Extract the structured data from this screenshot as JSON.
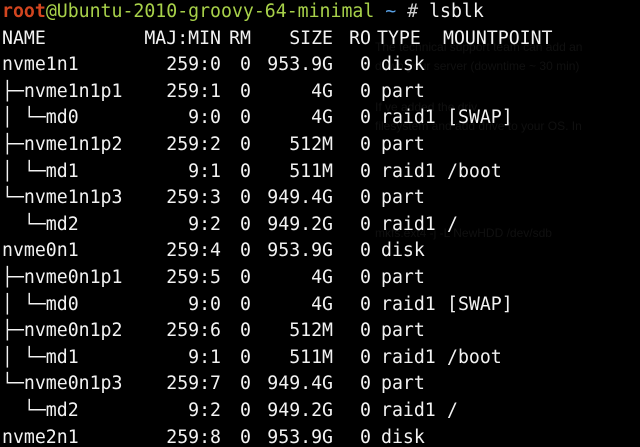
{
  "prompt": {
    "user": "root",
    "host": "@Ubuntu-2010-groovy-64-minimal",
    "path": "~",
    "symbol": "#",
    "command": "lsblk"
  },
  "table": {
    "headers": [
      "NAME",
      "MAJ:MIN",
      "RM",
      "SIZE",
      "RO",
      "TYPE",
      "MOUNTPOINT"
    ],
    "rows": [
      {
        "name": "nvme1n1",
        "majmin": "259:0",
        "rm": "0",
        "size": "953.9G",
        "ro": "0",
        "type": "disk",
        "mount": ""
      },
      {
        "name": "├─nvme1n1p1",
        "majmin": "259:1",
        "rm": "0",
        "size": "4G",
        "ro": "0",
        "type": "part",
        "mount": ""
      },
      {
        "name": "│ └─md0",
        "majmin": "9:0",
        "rm": "0",
        "size": "4G",
        "ro": "0",
        "type": "raid1",
        "mount": "[SWAP]"
      },
      {
        "name": "├─nvme1n1p2",
        "majmin": "259:2",
        "rm": "0",
        "size": "512M",
        "ro": "0",
        "type": "part",
        "mount": ""
      },
      {
        "name": "│ └─md1",
        "majmin": "9:1",
        "rm": "0",
        "size": "511M",
        "ro": "0",
        "type": "raid1",
        "mount": "/boot"
      },
      {
        "name": "└─nvme1n1p3",
        "majmin": "259:3",
        "rm": "0",
        "size": "949.4G",
        "ro": "0",
        "type": "part",
        "mount": ""
      },
      {
        "name": "  └─md2",
        "majmin": "9:2",
        "rm": "0",
        "size": "949.2G",
        "ro": "0",
        "type": "raid1",
        "mount": "/"
      },
      {
        "name": "nvme0n1",
        "majmin": "259:4",
        "rm": "0",
        "size": "953.9G",
        "ro": "0",
        "type": "disk",
        "mount": ""
      },
      {
        "name": "├─nvme0n1p1",
        "majmin": "259:5",
        "rm": "0",
        "size": "4G",
        "ro": "0",
        "type": "part",
        "mount": ""
      },
      {
        "name": "│ └─md0",
        "majmin": "9:0",
        "rm": "0",
        "size": "4G",
        "ro": "0",
        "type": "raid1",
        "mount": "[SWAP]"
      },
      {
        "name": "├─nvme0n1p2",
        "majmin": "259:6",
        "rm": "0",
        "size": "512M",
        "ro": "0",
        "type": "part",
        "mount": ""
      },
      {
        "name": "│ └─md1",
        "majmin": "9:1",
        "rm": "0",
        "size": "511M",
        "ro": "0",
        "type": "raid1",
        "mount": "/boot"
      },
      {
        "name": "└─nvme0n1p3",
        "majmin": "259:7",
        "rm": "0",
        "size": "949.4G",
        "ro": "0",
        "type": "part",
        "mount": ""
      },
      {
        "name": "  └─md2",
        "majmin": "9:2",
        "rm": "0",
        "size": "949.2G",
        "ro": "0",
        "type": "raid1",
        "mount": "/"
      },
      {
        "name": "nvme2n1",
        "majmin": "259:8",
        "rm": "0",
        "size": "953.9G",
        "ro": "0",
        "type": "disk",
        "mount": ""
      }
    ]
  },
  "background_doc": {
    "lines": [
      "The technical support team can add an",
      "down your server (downtime ~ 30 min)",
      "If                    ve added the driv",
      "filesystem and add drive to your OS. In",
      "mkfs.ext4 -j -L NewHDD /dev/sdb"
    ]
  },
  "colors": {
    "background": "#000000",
    "text": "#f2f2f2",
    "prompt_user": "#d2451f",
    "prompt_host": "#a8d14a",
    "prompt_path": "#5aa2e6"
  }
}
